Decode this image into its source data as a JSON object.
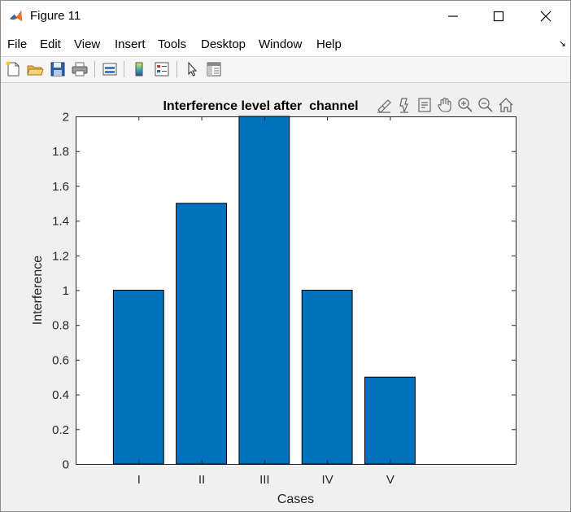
{
  "window": {
    "title": "Figure 11",
    "minimize_icon": "minimize-icon",
    "maximize_icon": "maximize-icon",
    "close_icon": "close-icon"
  },
  "menu": {
    "items": [
      "File",
      "Edit",
      "View",
      "Insert",
      "Tools",
      "Desktop",
      "Window",
      "Help"
    ]
  },
  "toolbar": {
    "icons": [
      "new-figure-icon",
      "open-file-icon",
      "save-icon",
      "print-icon",
      "link-plot-icon",
      "colorbar-icon",
      "legend-icon",
      "edit-plot-icon",
      "property-inspector-icon"
    ]
  },
  "axes_toolbar": {
    "icons": [
      "brush-icon",
      "data-tips-icon",
      "export-icon",
      "pan-icon",
      "zoom-in-icon",
      "zoom-out-icon",
      "home-icon"
    ]
  },
  "colors": {
    "bar_fill": "#0072bd",
    "axes_background": "#ffffff",
    "figure_background": "#f0f0f0"
  },
  "chart_data": {
    "type": "bar",
    "title": "Interference level after  channel",
    "xlabel": "Cases",
    "ylabel": "Interference",
    "categories": [
      "I",
      "II",
      "III",
      "IV",
      "V"
    ],
    "values": [
      1,
      1.5,
      2,
      1,
      0.5
    ],
    "ylim": [
      0,
      2
    ],
    "yticks": [
      0,
      0.2,
      0.4,
      0.6,
      0.8,
      1,
      1.2,
      1.4,
      1.6,
      1.8,
      2
    ],
    "ytick_labels": [
      "0",
      "0.2",
      "0.4",
      "0.6",
      "0.8",
      "1",
      "1.2",
      "1.4",
      "1.6",
      "1.8",
      "2"
    ],
    "grid": false,
    "legend": "none"
  }
}
